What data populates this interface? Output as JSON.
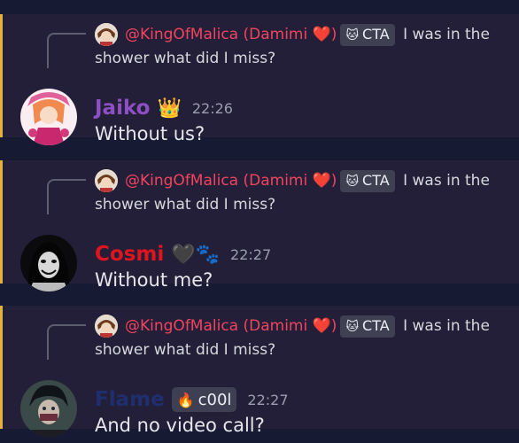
{
  "messages": [
    {
      "reply": {
        "username": "@KingOfMalica (Damimi",
        "heart": "❤️",
        "close": ")",
        "tag_label": "CTA",
        "text": "I was in the shower what did I miss?"
      },
      "author": {
        "name": "Jaiko",
        "color": "#8e4fc2",
        "badge": "👑"
      },
      "time": "22:26",
      "content": "Without us?"
    },
    {
      "reply": {
        "username": "@KingOfMalica (Damimi",
        "heart": "❤️",
        "close": ")",
        "tag_label": "CTA",
        "text": "I was in the shower what did I miss?"
      },
      "author": {
        "name": "Cosmi",
        "color": "#e0141e",
        "badge": "🖤🐾"
      },
      "time": "22:27",
      "content": "Without me?"
    },
    {
      "reply": {
        "username": "@KingOfMalica (Damimi",
        "heart": "❤️",
        "close": ")",
        "tag_label": "CTA",
        "text": "I was in the shower what did I miss?"
      },
      "author": {
        "name": "Flame",
        "color": "#1f2f6e",
        "tag": "c00l"
      },
      "time": "22:27",
      "content": "And no video call?"
    }
  ]
}
